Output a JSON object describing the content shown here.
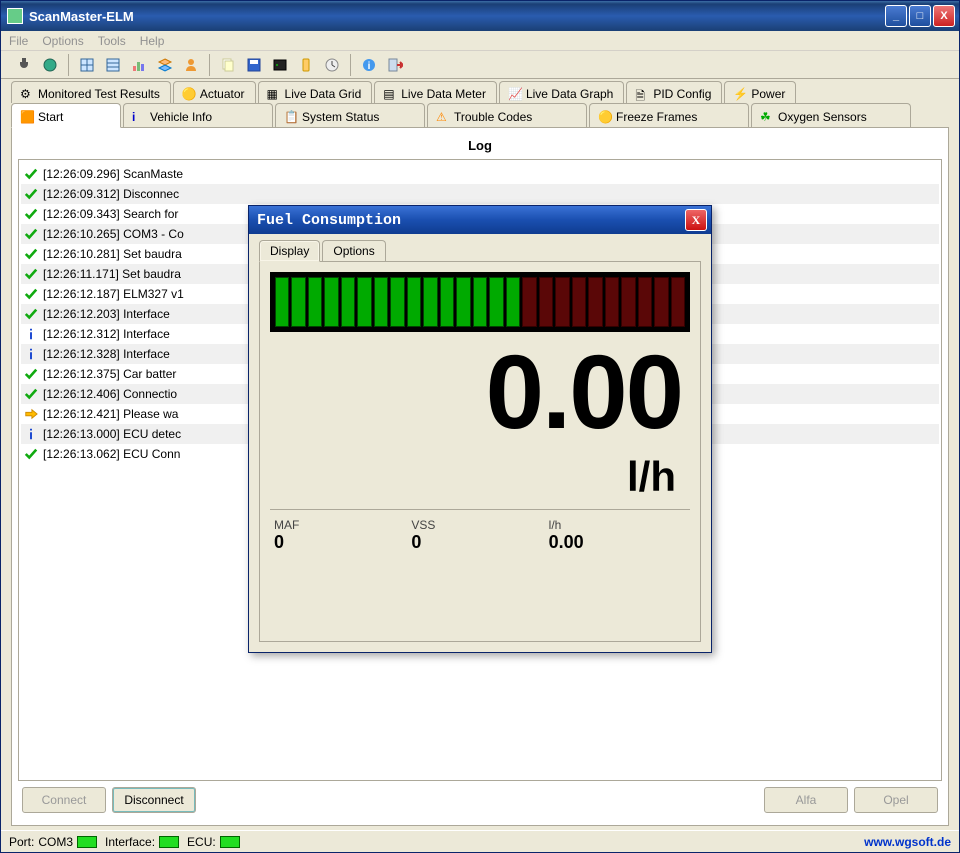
{
  "app": {
    "title": "ScanMaster-ELM"
  },
  "menu": {
    "file": "File",
    "options": "Options",
    "tools": "Tools",
    "help": "Help"
  },
  "tabs_top": {
    "monitored": "Monitored Test Results",
    "actuator": "Actuator",
    "grid": "Live Data Grid",
    "meter": "Live Data Meter",
    "graph": "Live Data Graph",
    "pid": "PID Config",
    "power": "Power"
  },
  "tabs_bottom": {
    "start": "Start",
    "vehicle": "Vehicle Info",
    "status": "System Status",
    "trouble": "Trouble Codes",
    "freeze": "Freeze Frames",
    "oxygen": "Oxygen Sensors"
  },
  "log": {
    "caption": "Log",
    "lines": [
      {
        "icon": "check",
        "text": "[12:26:09.296] ScanMaste"
      },
      {
        "icon": "check",
        "text": "[12:26:09.312] Disconnec"
      },
      {
        "icon": "check",
        "text": "[12:26:09.343] Search for"
      },
      {
        "icon": "check",
        "text": "[12:26:10.265] COM3 - Co"
      },
      {
        "icon": "check",
        "text": "[12:26:10.281] Set baudra"
      },
      {
        "icon": "check",
        "text": "[12:26:11.171] Set baudra"
      },
      {
        "icon": "check",
        "text": "[12:26:12.187] ELM327 v1"
      },
      {
        "icon": "check",
        "text": "[12:26:12.203] Interface"
      },
      {
        "icon": "info",
        "text": "[12:26:12.312] Interface"
      },
      {
        "icon": "info",
        "text": "[12:26:12.328] Interface"
      },
      {
        "icon": "check",
        "text": "[12:26:12.375] Car batter"
      },
      {
        "icon": "check",
        "text": "[12:26:12.406] Connectio"
      },
      {
        "icon": "arrow",
        "text": "[12:26:12.421] Please wa"
      },
      {
        "icon": "info",
        "text": "[12:26:13.000] ECU detec"
      },
      {
        "icon": "check",
        "text": "[12:26:13.062] ECU Conn"
      }
    ]
  },
  "buttons": {
    "connect": "Connect",
    "disconnect": "Disconnect",
    "alfa": "Alfa",
    "opel": "Opel"
  },
  "status": {
    "port_label": "Port:",
    "port_value": "COM3",
    "iface_label": "Interface:",
    "ecu_label": "ECU:",
    "url": "www.wgsoft.de"
  },
  "modal": {
    "title": "Fuel Consumption",
    "tabs": {
      "display": "Display",
      "options": "Options"
    },
    "value": "0.00",
    "unit": "l/h",
    "sub": {
      "maf_label": "MAF",
      "maf": "0",
      "vss_label": "VSS",
      "vss": "0",
      "lh_label": "l/h",
      "lh": "0.00"
    },
    "gauge": {
      "total": 25,
      "green": 15
    }
  }
}
